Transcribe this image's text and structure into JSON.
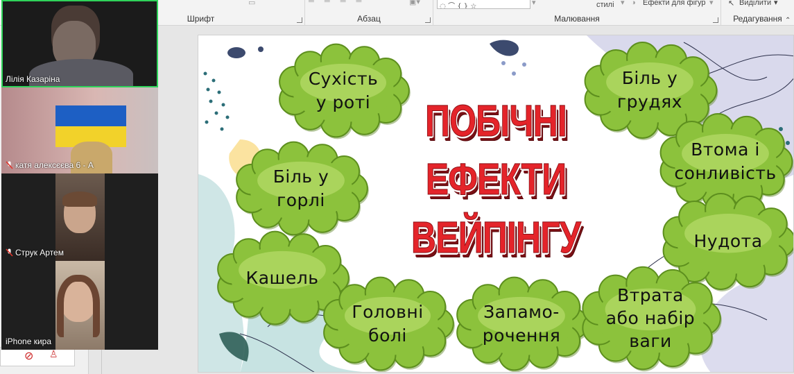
{
  "ribbon": {
    "groups": [
      {
        "label": "Шрифт"
      },
      {
        "label": "Абзац"
      },
      {
        "label": "Малювання"
      },
      {
        "label": "Редагування"
      }
    ],
    "styles_label": "стилі",
    "shape_effects_label": "Ефекти для фігур",
    "select_label": "Виділити"
  },
  "slide": {
    "title_lines": [
      "ПОБІЧНІ",
      "ЕФЕКТИ",
      "ВЕЙПІНГУ"
    ],
    "clouds": [
      {
        "text": "Сухість\nу роті"
      },
      {
        "text": "Біль у\nгорлі"
      },
      {
        "text": "Кашель"
      },
      {
        "text": "Головні\nболі"
      },
      {
        "text": "Запамо-\nрочення"
      },
      {
        "text": "Біль у\nгрудях"
      },
      {
        "text": "Втома і\nсонливість"
      },
      {
        "text": "Нудота"
      },
      {
        "text": "Втрата\nабо набір\nваги"
      }
    ],
    "colors": {
      "title_red": "#e4242a",
      "cloud_green": "#8cc23c",
      "cloud_border": "#5d8f1e"
    }
  },
  "participants": [
    {
      "name": "Лілія Казаріна",
      "muted": false,
      "active_speaker": true
    },
    {
      "name": "катя алексєєва 6 - А",
      "muted": true
    },
    {
      "name": "Струк Артем",
      "muted": true
    },
    {
      "name": "iPhone кира",
      "muted": false
    }
  ]
}
